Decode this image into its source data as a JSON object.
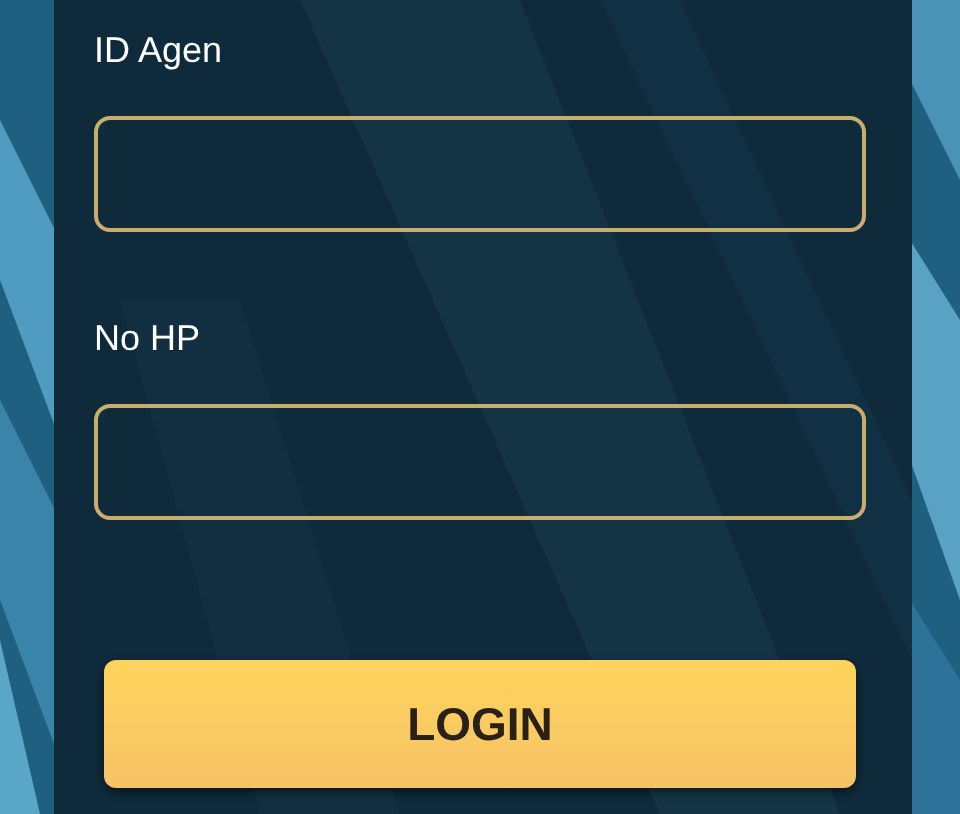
{
  "fields": [
    {
      "label": "ID Agen"
    },
    {
      "label": "No HP"
    }
  ],
  "login_button": {
    "label": "LOGIN"
  }
}
